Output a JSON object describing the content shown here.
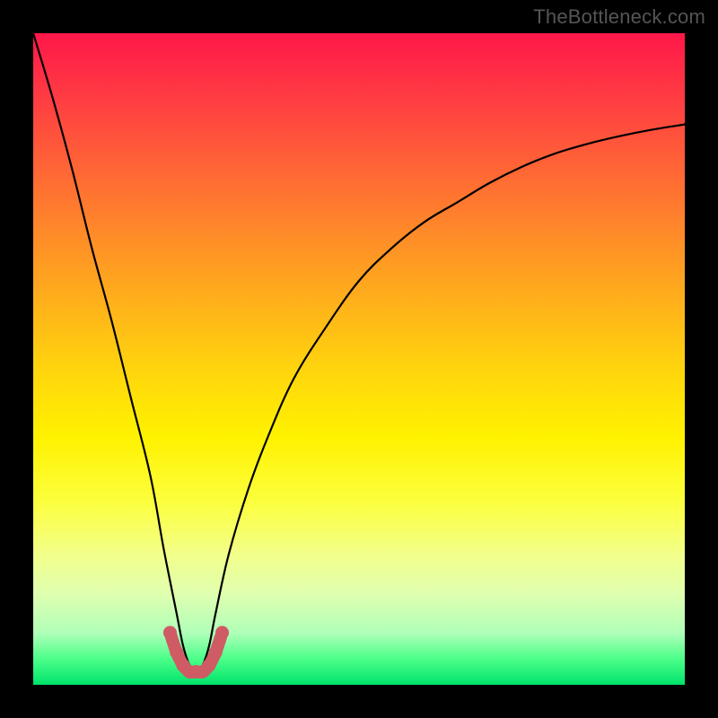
{
  "watermark": "TheBottleneck.com",
  "chart_data": {
    "type": "line",
    "title": "",
    "xlabel": "",
    "ylabel": "",
    "xlim": [
      0,
      100
    ],
    "ylim": [
      0,
      100
    ],
    "grid": false,
    "legend": false,
    "note": "Gradient-background bottleneck curve. X is an implicit component scale; Y is bottleneck percentage (top=high bottleneck red, bottom=low bottleneck green). The curve dips to a minimum near x≈25 and rises toward both sides.",
    "series": [
      {
        "name": "bottleneck_curve",
        "color": "#000000",
        "x": [
          0,
          3,
          6,
          9,
          12,
          15,
          18,
          20,
          22,
          23,
          24,
          25,
          26,
          27,
          28,
          30,
          33,
          36,
          40,
          45,
          50,
          55,
          60,
          65,
          70,
          75,
          80,
          85,
          90,
          95,
          100
        ],
        "values": [
          100,
          90,
          79,
          67,
          56,
          44,
          32,
          21,
          11,
          6,
          3,
          2,
          3,
          6,
          11,
          20,
          30,
          38,
          47,
          55,
          62,
          67,
          71,
          74,
          77,
          79.5,
          81.5,
          83,
          84.2,
          85.2,
          86
        ]
      },
      {
        "name": "minimum_highlight",
        "color": "#cf5b64",
        "style": "thick_dotted",
        "x": [
          21,
          22,
          23,
          24,
          25,
          26,
          27,
          28,
          29
        ],
        "values": [
          8,
          5,
          3,
          2,
          2,
          2,
          3,
          5,
          8
        ]
      }
    ]
  }
}
